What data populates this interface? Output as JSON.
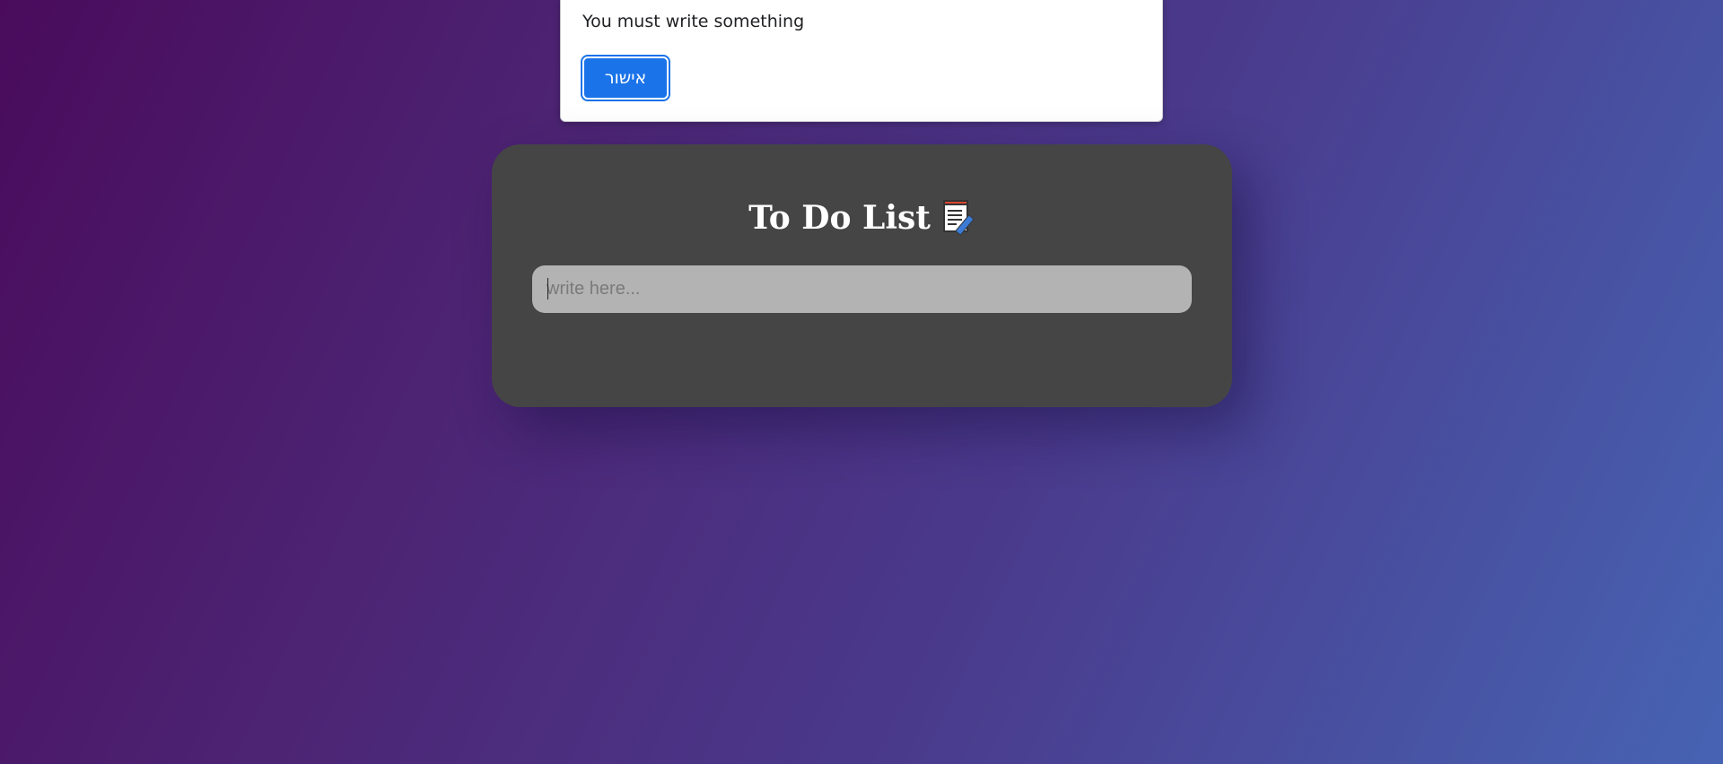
{
  "alert": {
    "message": "You must write something",
    "ok_label": "אישור"
  },
  "todo": {
    "title": "To Do List",
    "title_icon": "notepad-pencil-icon",
    "input": {
      "value": "",
      "placeholder": "write here..."
    }
  },
  "colors": {
    "card_background": "#454545",
    "input_background": "#b3b3b3",
    "alert_button": "#1a73e8",
    "gradient_start": "#4a0b5c",
    "gradient_end": "#4763b3"
  }
}
